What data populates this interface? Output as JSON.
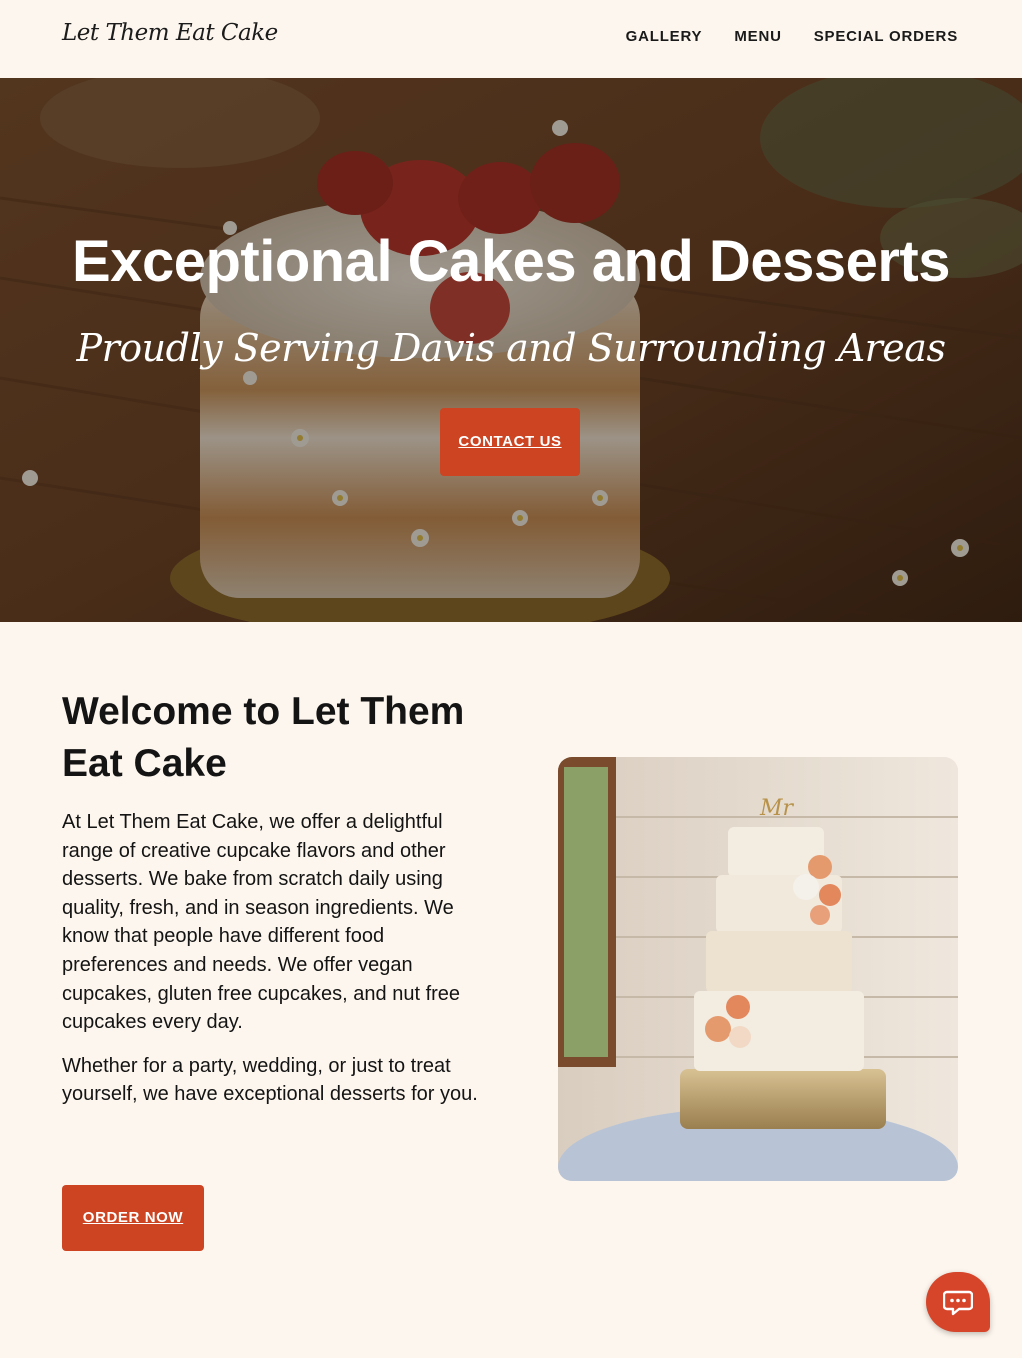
{
  "header": {
    "logo_text": "Let Them Eat Cake",
    "nav": [
      {
        "label": "GALLERY"
      },
      {
        "label": "MENU"
      },
      {
        "label": "SPECIAL ORDERS"
      }
    ]
  },
  "hero": {
    "title": "Exceptional Cakes and Desserts",
    "subtitle": "Proudly Serving Davis and Surrounding Areas",
    "button_label": "CONTACT US"
  },
  "welcome": {
    "title": "Welcome to Let Them Eat Cake",
    "paragraphs": [
      "At Let Them Eat Cake, we offer a delightful range of creative cupcake flavors and other desserts. We bake from scratch daily using quality, fresh, and in season ingredients. We know that people have different food preferences and needs. We offer vegan cupcakes, gluten free cupcakes, and nut free cupcakes every day.",
      "Whether for a party, wedding, or just to treat yourself, we have exceptional desserts for you."
    ],
    "button_label": "ORDER NOW"
  },
  "colors": {
    "background": "#fdf6ee",
    "accent": "#cc4422",
    "text": "#141414"
  },
  "icons": {
    "chat": "chat-bubble-icon"
  }
}
